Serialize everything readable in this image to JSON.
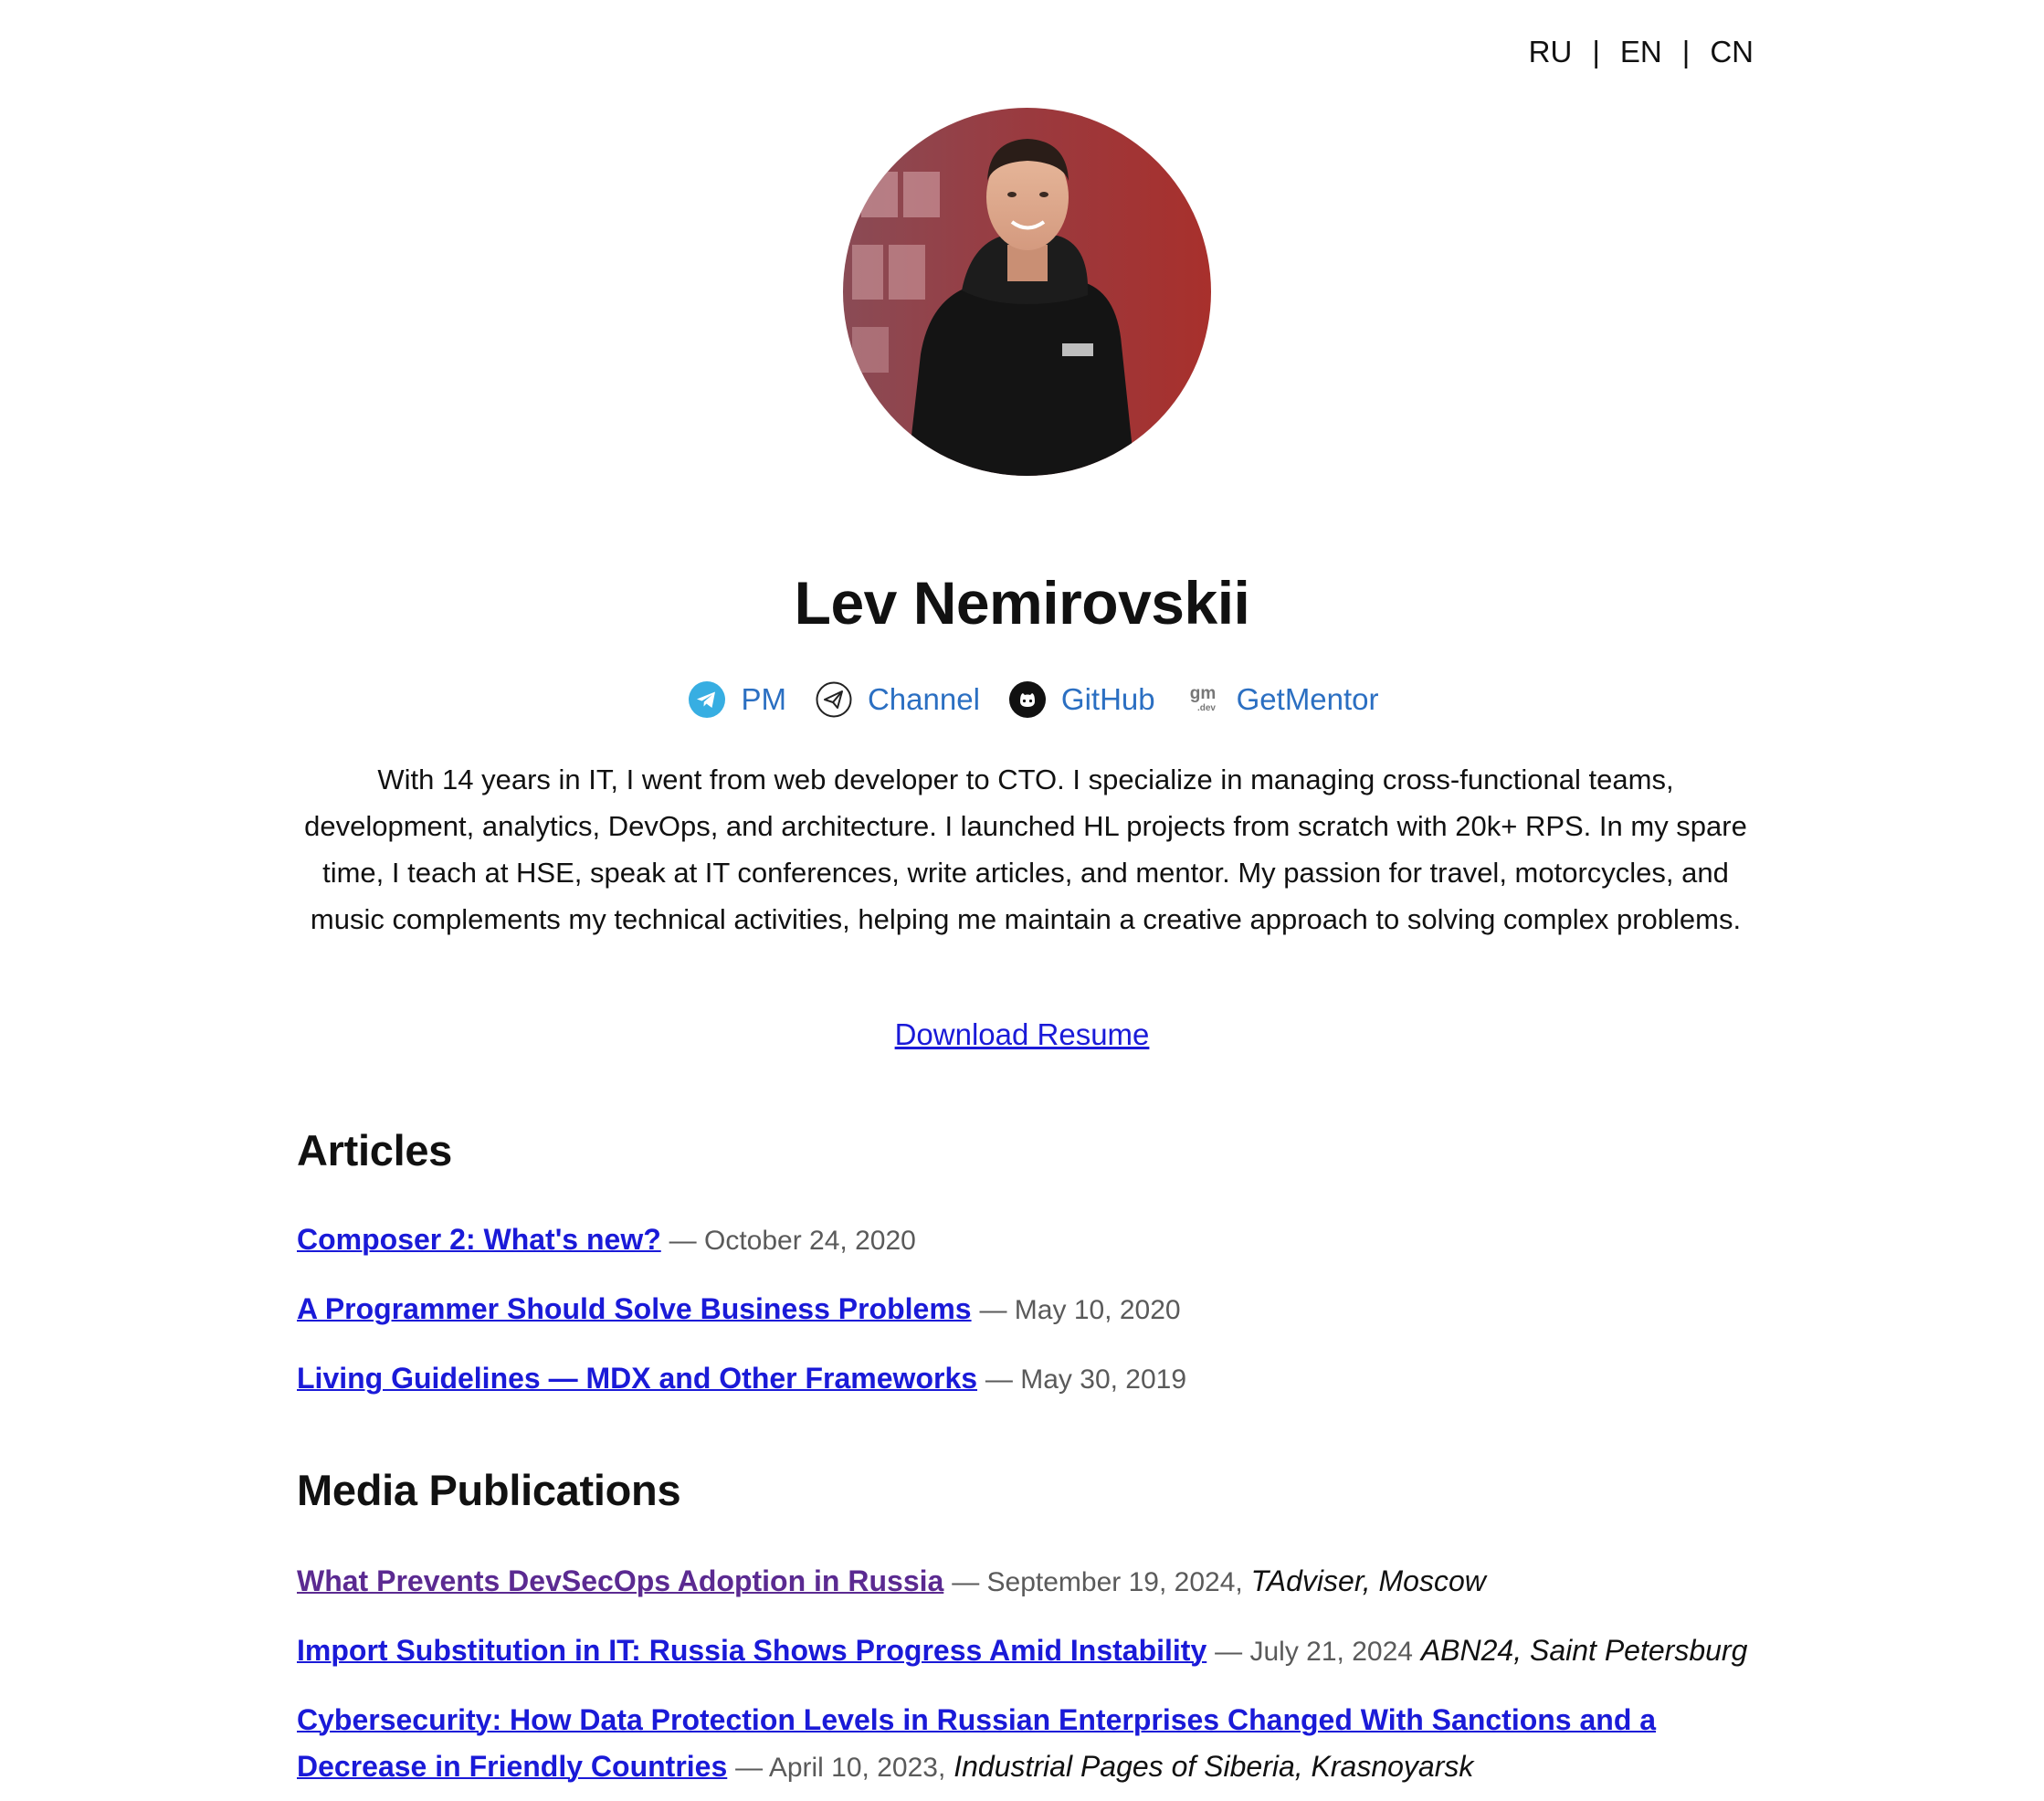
{
  "lang": {
    "items": [
      "RU",
      "EN",
      "CN"
    ],
    "separator": "|"
  },
  "profile": {
    "name": "Lev Nemirovskii",
    "bio": "With 14 years in IT, I went from web developer to CTO. I specialize in managing cross-functional teams, development, analytics, DevOps, and architecture. I launched HL projects from scratch with 20k+ RPS. In my spare time, I teach at HSE, speak at IT conferences, write articles, and mentor. My passion for travel, motorcycles, and music complements my technical activities, helping me maintain a creative approach to solving complex problems.",
    "resume_label": "Download Resume"
  },
  "socials": [
    {
      "label": "PM",
      "icon": "telegram-icon"
    },
    {
      "label": "Channel",
      "icon": "paper-plane-icon"
    },
    {
      "label": "GitHub",
      "icon": "github-icon"
    },
    {
      "label": "GetMentor",
      "icon": "getmentor-icon",
      "icon_text": "gm",
      "icon_subtext": ".dev"
    }
  ],
  "articles": {
    "title": "Articles",
    "items": [
      {
        "title": "Composer 2: What's new?",
        "date": "— October 24, 2020"
      },
      {
        "title": "A Programmer Should Solve Business Problems",
        "date": "— May 10, 2020"
      },
      {
        "title": "Living Guidelines — MDX and Other Frameworks",
        "date": "— May 30, 2019"
      }
    ]
  },
  "media": {
    "title": "Media Publications",
    "items": [
      {
        "title": "What Prevents DevSecOps Adoption in Russia",
        "date": "— September 19, 2024,",
        "source": "TAdviser, Moscow",
        "visited": true
      },
      {
        "title": "Import Substitution in IT: Russia Shows Progress Amid Instability",
        "date": "— July 21, 2024",
        "source": "ABN24, Saint Petersburg",
        "visited": false
      },
      {
        "title": "Cybersecurity: How Data Protection Levels in Russian Enterprises Changed With Sanctions and a Decrease in Friendly Countries",
        "date": "— April 10, 2023,",
        "source": "Industrial Pages of Siberia, Krasnoyarsk",
        "visited": false
      }
    ]
  },
  "colors": {
    "link": "#1a1ad8",
    "visited_link": "#5b2a91",
    "social_link": "#2b6fc2",
    "telegram": "#37aee2",
    "muted": "#5a5a5a"
  }
}
